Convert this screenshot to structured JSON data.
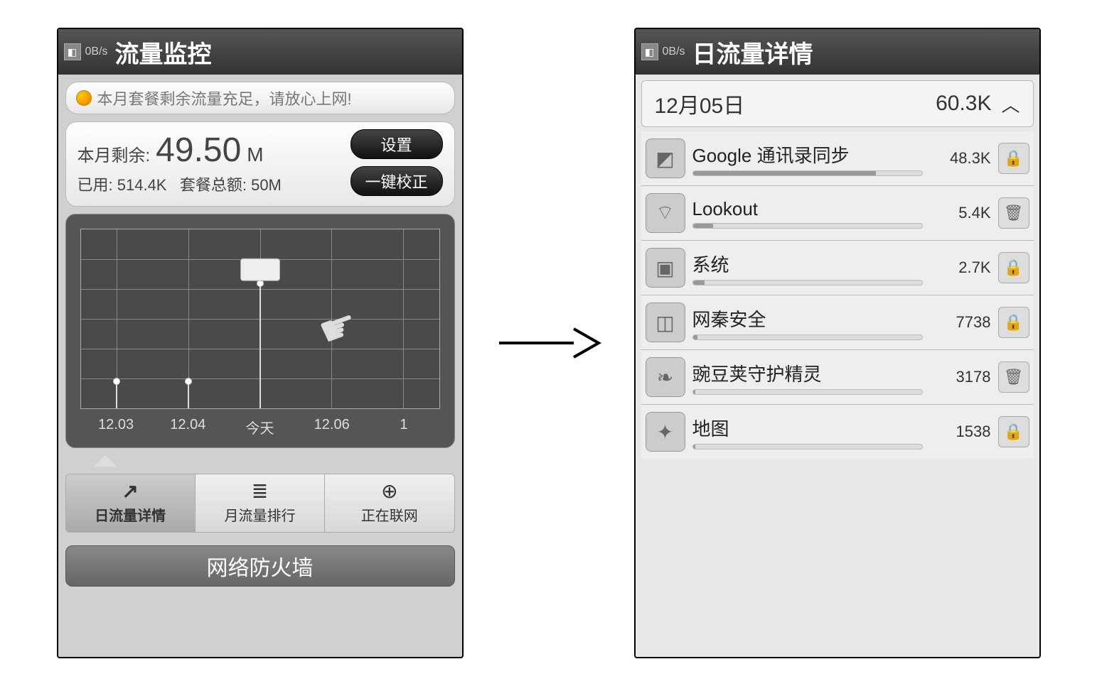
{
  "status": {
    "speed": "0B/s"
  },
  "screenA": {
    "title": "流量监控",
    "banner": "本月套餐剩余流量充足，请放心上网!",
    "summary": {
      "remaining_label": "本月剩余:",
      "remaining_value": "49.50",
      "remaining_unit": "M",
      "used_label": "已用:",
      "used_value": "514.4K",
      "quota_label": "套餐总额:",
      "quota_value": "50M",
      "btn_settings": "设置",
      "btn_calibrate": "一键校正"
    },
    "tabs": {
      "daily": "日流量详情",
      "monthly": "月流量排行",
      "live": "正在联网"
    },
    "firewall": "网络防火墙"
  },
  "screenB": {
    "title": "日流量详情",
    "date": "12月05日",
    "total": "60.3K",
    "apps": [
      {
        "name": "Google 通讯录同步",
        "value": "48.3K",
        "pct": 80,
        "action": "lock",
        "icon": "◩"
      },
      {
        "name": "Lookout",
        "value": "5.4K",
        "pct": 9,
        "action": "trash",
        "icon": "⌔"
      },
      {
        "name": "系统",
        "value": "2.7K",
        "pct": 5,
        "action": "lock",
        "icon": "▣"
      },
      {
        "name": "网秦安全",
        "value": "7738",
        "pct": 2,
        "action": "lock",
        "icon": "◫"
      },
      {
        "name": "豌豆荚守护精灵",
        "value": "3178",
        "pct": 1,
        "action": "trash",
        "icon": "❧"
      },
      {
        "name": "地图",
        "value": "1538",
        "pct": 1,
        "action": "lock",
        "icon": "✦"
      }
    ]
  },
  "chart_data": {
    "type": "line",
    "title": "",
    "xlabel": "",
    "ylabel": "",
    "categories": [
      "12.03",
      "12.04",
      "今天",
      "12.06",
      "1"
    ],
    "values": [
      15,
      15,
      70,
      null,
      null
    ],
    "ylim": [
      0,
      100
    ],
    "note": "Daily data-usage line chart; points at 12.03 and 12.04 are low and equal, '今天' (today) is a high peak with a tooltip. 12.06 and the truncated next label have no plotted values visible."
  }
}
